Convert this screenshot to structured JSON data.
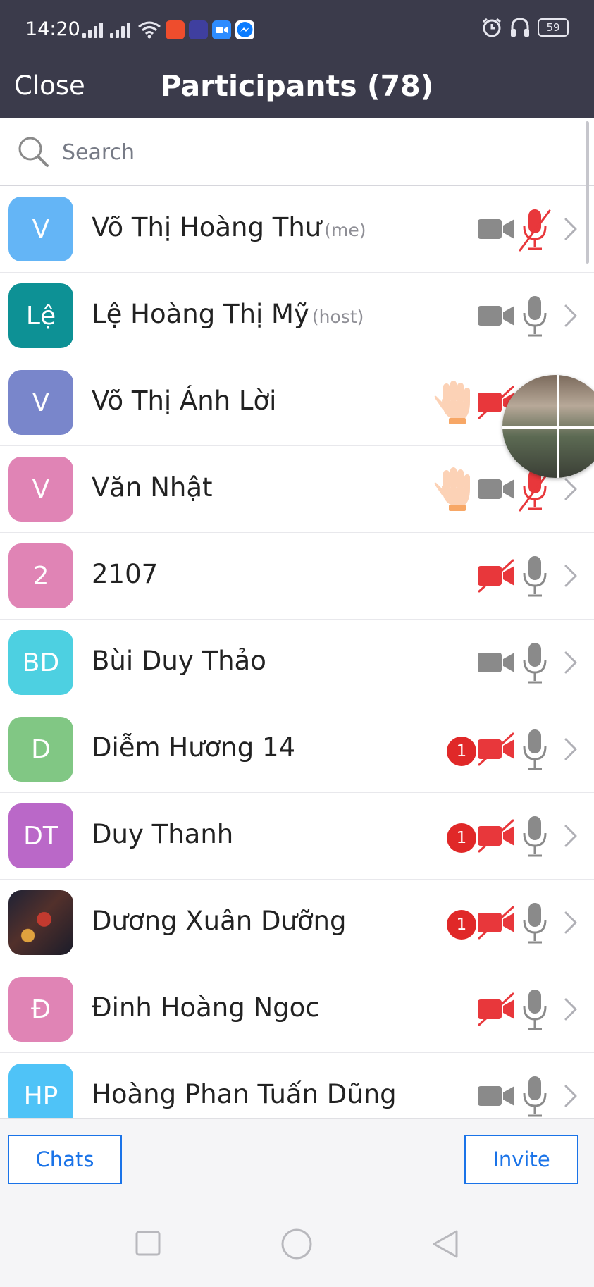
{
  "status_bar": {
    "time": "14:20",
    "battery": "59"
  },
  "header": {
    "close_label": "Close",
    "title": "Participants (78)"
  },
  "search": {
    "placeholder": "Search"
  },
  "participants": [
    {
      "initials": "V",
      "name": "Võ Thị Hoàng Thư",
      "role": "(me)",
      "avatar_color": "#64b5f6",
      "raised_hand": false,
      "unread": "",
      "video": "on",
      "mic": "muted"
    },
    {
      "initials": "Lệ",
      "name": "Lệ Hoàng Thị Mỹ",
      "role": "(host)",
      "avatar_color": "#0d9195",
      "raised_hand": false,
      "unread": "",
      "video": "on",
      "mic": "on"
    },
    {
      "initials": "V",
      "name": "Võ Thị Ánh Lời",
      "role": "",
      "avatar_color": "#7986cb",
      "raised_hand": true,
      "unread": "",
      "video": "off",
      "mic": "hidden"
    },
    {
      "initials": "V",
      "name": "Văn Nhật",
      "role": "",
      "avatar_color": "#e084b5",
      "raised_hand": true,
      "unread": "",
      "video": "on",
      "mic": "muted"
    },
    {
      "initials": "2",
      "name": "2107",
      "role": "",
      "avatar_color": "#e084b5",
      "raised_hand": false,
      "unread": "",
      "video": "off",
      "mic": "on"
    },
    {
      "initials": "BD",
      "name": "Bùi Duy Thảo",
      "role": "",
      "avatar_color": "#4dd0e1",
      "raised_hand": false,
      "unread": "",
      "video": "on",
      "mic": "on"
    },
    {
      "initials": "D",
      "name": "Diễm Hương 14",
      "role": "",
      "avatar_color": "#81c784",
      "raised_hand": false,
      "unread": "1",
      "video": "off",
      "mic": "on"
    },
    {
      "initials": "DT",
      "name": "Duy Thanh",
      "role": "",
      "avatar_color": "#ba68c8",
      "raised_hand": false,
      "unread": "1",
      "video": "off",
      "mic": "on"
    },
    {
      "initials": "",
      "name": "Dương Xuân Dưỡng",
      "role": "",
      "avatar_color": "image",
      "raised_hand": false,
      "unread": "1",
      "video": "off",
      "mic": "on"
    },
    {
      "initials": "Đ",
      "name": "Đinh Hoàng Ngoc",
      "role": "",
      "avatar_color": "#e084b5",
      "raised_hand": false,
      "unread": "",
      "video": "off",
      "mic": "on"
    },
    {
      "initials": "HP",
      "name": "Hoàng Phan Tuấn Dũng",
      "role": "",
      "avatar_color": "#4fc3f7",
      "raised_hand": false,
      "unread": "",
      "video": "on",
      "mic": "on"
    }
  ],
  "footer": {
    "chats_label": "Chats",
    "invite_label": "Invite"
  },
  "colors": {
    "header_bg": "#3b3b4b",
    "accent": "#1a73e8",
    "muted_red": "#e8373b",
    "icon_gray": "#8a8a8a",
    "badge_red": "#e02828"
  }
}
